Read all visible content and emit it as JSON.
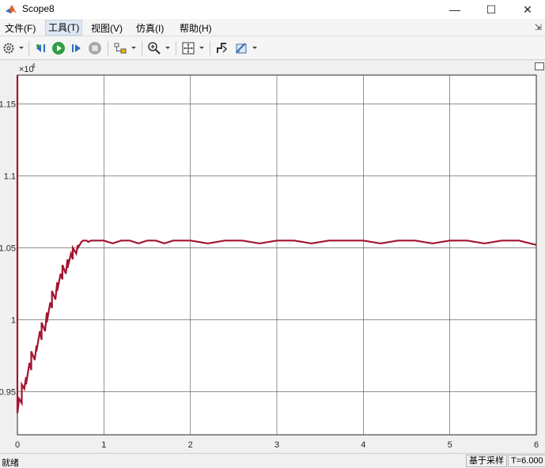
{
  "window": {
    "title": "Scope8",
    "minimize": "—",
    "maximize": "☐",
    "close": "✕"
  },
  "menu": {
    "items": [
      "文件(F)",
      "工具(T)",
      "视图(V)",
      "仿真(I)",
      "帮助(H)"
    ],
    "active_index": 1,
    "pin": "⇲"
  },
  "toolbar": {
    "icons": [
      "gear-icon",
      "step-back-icon",
      "run-icon",
      "step-forward-icon",
      "stop-icon",
      "highlight-block-icon",
      "zoom-in-icon",
      "fit-to-view-icon",
      "signal-trigger-icon",
      "cursor-measure-icon"
    ]
  },
  "status": {
    "left": "就绪",
    "mode": "基于采样",
    "time": "T=6.000"
  },
  "chart_data": {
    "type": "line",
    "xlim": [
      0,
      6
    ],
    "ylim": [
      9.2,
      11.7
    ],
    "y_scale_label": "×10",
    "y_scale_exponent": "4",
    "x_ticks": [
      "0",
      "1",
      "2",
      "3",
      "4",
      "5",
      "6"
    ],
    "y_ticks": [
      "0.95",
      "1",
      "1.05",
      "1.1",
      "1.15"
    ],
    "y_tick_values": [
      9.5,
      10.0,
      10.5,
      11.0,
      11.5
    ],
    "grid": true,
    "line_color": "#a2142f",
    "series": [
      {
        "x": [
          0.0,
          0.0,
          0.02,
          0.05,
          0.05,
          0.08,
          0.1,
          0.1,
          0.14,
          0.16,
          0.16,
          0.2,
          0.22,
          0.22,
          0.26,
          0.28,
          0.28,
          0.32,
          0.34,
          0.34,
          0.38,
          0.4,
          0.4,
          0.44,
          0.46,
          0.46,
          0.5,
          0.52,
          0.52,
          0.56,
          0.58,
          0.58,
          0.62,
          0.64,
          0.64,
          0.68,
          0.7,
          0.7,
          0.74,
          0.76,
          0.8,
          0.82,
          0.85,
          0.9,
          1.0,
          1.1,
          1.2,
          1.3,
          1.4,
          1.5,
          1.6,
          1.7,
          1.8,
          1.9,
          2.0,
          2.2,
          2.4,
          2.6,
          2.8,
          3.0,
          3.2,
          3.4,
          3.6,
          3.8,
          4.0,
          4.2,
          4.4,
          4.6,
          4.8,
          5.0,
          5.2,
          5.4,
          5.6,
          5.8,
          6.0
        ],
        "y": [
          11.7,
          9.35,
          9.45,
          9.42,
          9.55,
          9.52,
          9.6,
          9.55,
          9.7,
          9.65,
          9.78,
          9.72,
          9.82,
          9.78,
          9.92,
          9.86,
          9.98,
          9.92,
          10.05,
          9.98,
          10.12,
          10.08,
          10.2,
          10.14,
          10.26,
          10.2,
          10.32,
          10.28,
          10.38,
          10.32,
          10.42,
          10.36,
          10.46,
          10.42,
          10.5,
          10.46,
          10.52,
          10.5,
          10.54,
          10.55,
          10.55,
          10.54,
          10.55,
          10.55,
          10.55,
          10.53,
          10.55,
          10.55,
          10.53,
          10.55,
          10.55,
          10.53,
          10.55,
          10.55,
          10.55,
          10.53,
          10.55,
          10.55,
          10.53,
          10.55,
          10.55,
          10.53,
          10.55,
          10.55,
          10.55,
          10.53,
          10.55,
          10.55,
          10.53,
          10.55,
          10.55,
          10.53,
          10.55,
          10.55,
          10.52
        ]
      }
    ]
  }
}
